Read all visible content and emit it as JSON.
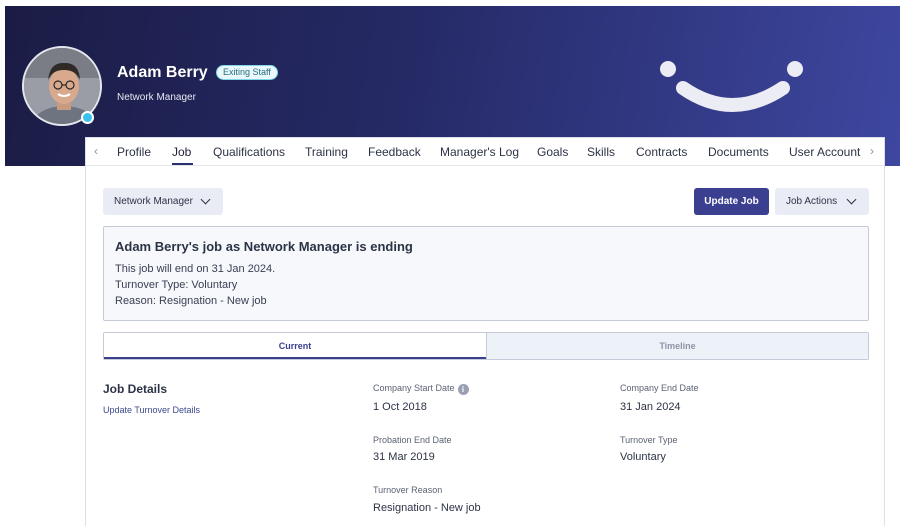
{
  "profile": {
    "name": "Adam Berry",
    "status_badge": "Exiting Staff",
    "role": "Network Manager"
  },
  "tabs": [
    "Profile",
    "Job",
    "Qualifications",
    "Training",
    "Feedback",
    "Manager's Log",
    "Goals",
    "Skills",
    "Contracts",
    "Documents",
    "User Account"
  ],
  "active_tab": "Job",
  "toolbar": {
    "job_select": "Network Manager",
    "update_job": "Update Job",
    "job_actions": "Job Actions"
  },
  "notice": {
    "title": "Adam Berry's job as Network Manager is ending",
    "line1": "This job will end on 31 Jan 2024.",
    "line2": "Turnover Type: Voluntary",
    "line3": "Reason: Resignation - New job"
  },
  "view_toggle": {
    "current": "Current",
    "timeline": "Timeline"
  },
  "job_details": {
    "title": "Job Details",
    "link": "Update Turnover Details",
    "fields": {
      "company_start_label": "Company Start Date",
      "company_start_value": "1 Oct 2018",
      "company_end_label": "Company End Date",
      "company_end_value": "31 Jan 2024",
      "probation_end_label": "Probation End Date",
      "probation_end_value": "31 Mar 2019",
      "turnover_type_label": "Turnover Type",
      "turnover_type_value": "Voluntary",
      "turnover_reason_label": "Turnover Reason",
      "turnover_reason_value": "Resignation - New job"
    }
  },
  "icons": [
    "chevron-left-icon",
    "chevron-right-icon",
    "chevron-down-icon",
    "info-icon",
    "smile-logo-icon"
  ],
  "colors": {
    "header_dark": "#1b1c45",
    "header_light": "#3e47a0",
    "primary": "#3b3f90",
    "status_online": "#39c2f0"
  }
}
